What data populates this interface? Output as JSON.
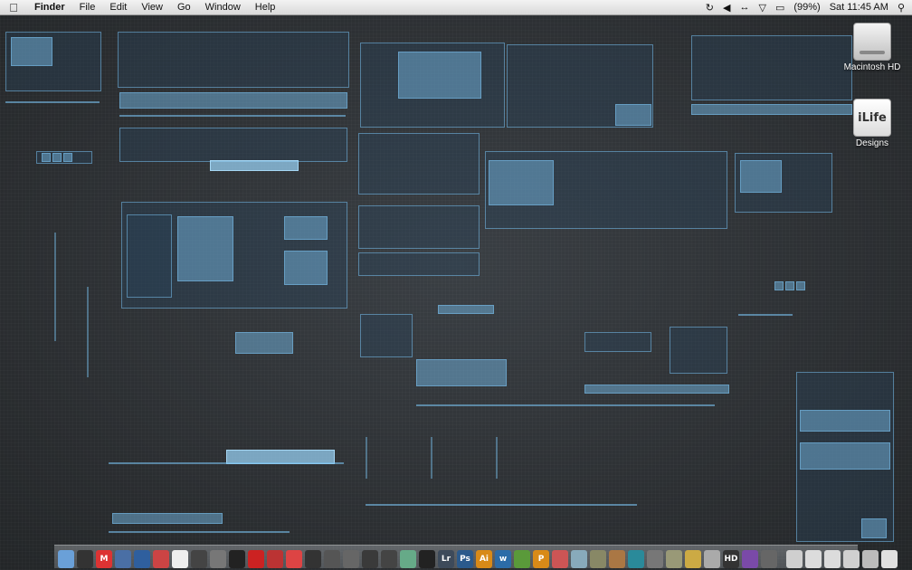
{
  "menubar": {
    "apple_icon": "apple-logo-icon",
    "items": [
      "Finder",
      "File",
      "Edit",
      "View",
      "Go",
      "Window",
      "Help"
    ],
    "battery": "(99%)",
    "clock": "Sat 11:45 AM"
  },
  "desktop_icons": [
    {
      "label": "Macintosh HD",
      "icon": "hard-drive-icon"
    },
    {
      "label": "Designs",
      "icon": "ilife-folder-icon",
      "badge": "iLife"
    }
  ],
  "dock": {
    "apps": [
      {
        "name": "finder",
        "color": "#6aa0d8",
        "glyph": ""
      },
      {
        "name": "dashboard",
        "color": "#333",
        "glyph": ""
      },
      {
        "name": "mail",
        "color": "#d33",
        "glyph": "M"
      },
      {
        "name": "system",
        "color": "#4a6fa5",
        "glyph": ""
      },
      {
        "name": "firefox",
        "color": "#2f5f9e",
        "glyph": ""
      },
      {
        "name": "ical",
        "color": "#c44",
        "glyph": ""
      },
      {
        "name": "calendar",
        "color": "#eee",
        "glyph": ""
      },
      {
        "name": "monitor",
        "color": "#444",
        "glyph": ""
      },
      {
        "name": "tool",
        "color": "#777",
        "glyph": ""
      },
      {
        "name": "display",
        "color": "#222",
        "glyph": ""
      },
      {
        "name": "red-app",
        "color": "#c22",
        "glyph": ""
      },
      {
        "name": "video",
        "color": "#b33",
        "glyph": ""
      },
      {
        "name": "red-white",
        "color": "#d44",
        "glyph": ""
      },
      {
        "name": "clapper",
        "color": "#333",
        "glyph": ""
      },
      {
        "name": "film",
        "color": "#555",
        "glyph": ""
      },
      {
        "name": "bars",
        "color": "#666",
        "glyph": ""
      },
      {
        "name": "guitar",
        "color": "#3a3a3a",
        "glyph": ""
      },
      {
        "name": "camera",
        "color": "#444",
        "glyph": ""
      },
      {
        "name": "iphoto",
        "color": "#6a8",
        "glyph": ""
      },
      {
        "name": "aperture",
        "color": "#222",
        "glyph": ""
      },
      {
        "name": "lightroom",
        "color": "#3d4a5a",
        "glyph": "Lr"
      },
      {
        "name": "photoshop",
        "color": "#2b5a8c",
        "glyph": "Ps"
      },
      {
        "name": "illustrator",
        "color": "#d88a18",
        "glyph": "Ai"
      },
      {
        "name": "script",
        "color": "#2c6ca8",
        "glyph": "w"
      },
      {
        "name": "leaf",
        "color": "#5a9a3a",
        "glyph": ""
      },
      {
        "name": "pages",
        "color": "#d88a18",
        "glyph": "P"
      },
      {
        "name": "stamp",
        "color": "#c55",
        "glyph": ""
      },
      {
        "name": "preview",
        "color": "#8ab",
        "glyph": ""
      },
      {
        "name": "hammer",
        "color": "#886",
        "glyph": ""
      },
      {
        "name": "coin",
        "color": "#a74",
        "glyph": ""
      },
      {
        "name": "timemachine",
        "color": "#2a8a9a",
        "glyph": ""
      },
      {
        "name": "keys",
        "color": "#777",
        "glyph": ""
      },
      {
        "name": "rocket",
        "color": "#997",
        "glyph": ""
      },
      {
        "name": "parrot",
        "color": "#ca4",
        "glyph": ""
      },
      {
        "name": "boxing",
        "color": "#aaa",
        "glyph": ""
      },
      {
        "name": "hd",
        "color": "#333",
        "glyph": "HD"
      },
      {
        "name": "orb",
        "color": "#7a4aa8",
        "glyph": ""
      },
      {
        "name": "gear",
        "color": "#666",
        "glyph": ""
      }
    ],
    "stacks": [
      {
        "name": "stack-1",
        "color": "#cfcfcf"
      },
      {
        "name": "stack-2",
        "color": "#dcdcdc"
      },
      {
        "name": "stack-3",
        "color": "#dcdcdc"
      },
      {
        "name": "stack-4",
        "color": "#d0d0d0"
      },
      {
        "name": "stack-5",
        "color": "#bbb"
      },
      {
        "name": "trash",
        "color": "#e0e0e0"
      }
    ]
  }
}
